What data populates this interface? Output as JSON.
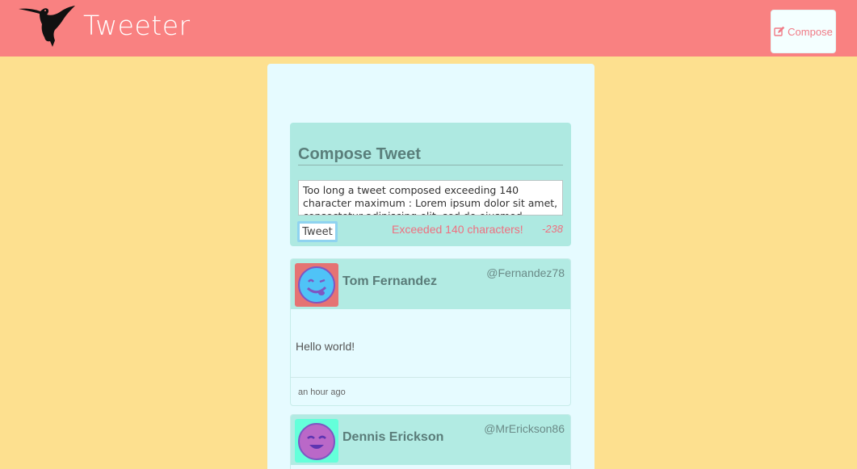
{
  "app": {
    "title": "Tweeter",
    "compose_label": "Compose",
    "colors": {
      "navbar": "#f98181",
      "background": "#fde08f",
      "panel": "#e6fbff",
      "accent": "#aee9e1",
      "error": "#ef6f7f"
    }
  },
  "composer": {
    "title": "Compose Tweet",
    "text": "Too long a tweet composed exceeding 140 character maximum : Lorem ipsum dolor sit amet, consectetur adipiscing elit, sed do eiusmod tempor incididunt ut",
    "button_label": "Tweet",
    "error": "Exceeded 140 characters!",
    "counter": "-238"
  },
  "tweets": [
    {
      "name": "Tom Fernandez",
      "handle": "@Fernandez78",
      "text": "Hello world!",
      "time": "an hour ago",
      "avatar_bg": "#e57373",
      "avatar_face": "#4fc3f7"
    },
    {
      "name": "Dennis Erickson",
      "handle": "@MrErickson86",
      "avatar_bg": "#64ffda",
      "avatar_face": "#ba68c8"
    }
  ]
}
